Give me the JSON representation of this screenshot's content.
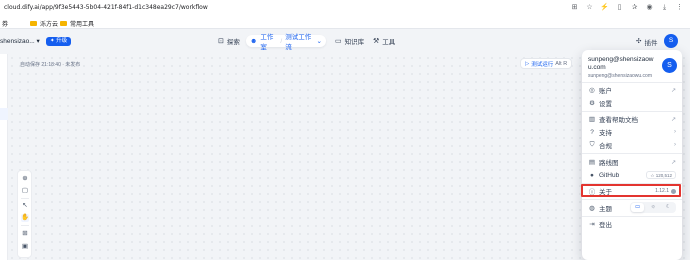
{
  "browser": {
    "url": "cloud.dify.ai/app/9f3e5443-5b04-421f-84f1-d1c348ea29c7/workflow",
    "bookmarks": [
      "券",
      "泺方云",
      "常用工具"
    ]
  },
  "header": {
    "workspace": "shensizao...",
    "upgrade": "升级",
    "nav": {
      "explore": "探索",
      "studio": "工作室",
      "workflow_name": "测试工作流",
      "knowledge": "知识库",
      "tools": "工具"
    },
    "plugins": "插件",
    "avatar_letter": "S"
  },
  "canvas": {
    "autosave": "自动保存 21:18:40 · 未发布",
    "run_button": "测试运行",
    "run_shortcut": "Alt R"
  },
  "account_menu": {
    "name": "sunpeng@shensizaowu.com",
    "email": "sunpeng@shensizaowu.com",
    "avatar_letter": "S",
    "items": {
      "account": "账户",
      "settings": "设置",
      "docs": "查看帮助文档",
      "support": "支持",
      "compliance": "合规",
      "roadmap": "路线图",
      "github": "GitHub",
      "github_stars": "120,512",
      "about": "关于",
      "version": "1.12.1",
      "theme": "主题",
      "logout": "登出"
    }
  },
  "colors": {
    "accent": "#155eef",
    "highlight": "#e3342f"
  }
}
